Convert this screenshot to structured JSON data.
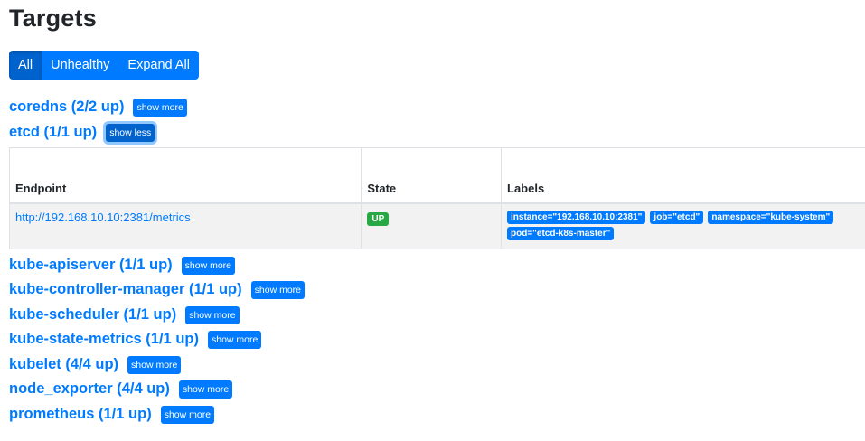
{
  "page": {
    "title": "Targets"
  },
  "filters": {
    "all_label": "All",
    "unhealthy_label": "Unhealthy",
    "expand_all_label": "Expand All"
  },
  "pools_top": [
    {
      "title": "coredns (2/2 up)",
      "toggle": "show more"
    },
    {
      "title": "etcd (1/1 up)",
      "toggle": "show less"
    }
  ],
  "etcd_table": {
    "headers": {
      "endpoint": "Endpoint",
      "state": "State",
      "labels": "Labels"
    },
    "rows": [
      {
        "endpoint": "http://192.168.10.10:2381/metrics",
        "state": "UP",
        "labels": [
          "instance=\"192.168.10.10:2381\"",
          "job=\"etcd\"",
          "namespace=\"kube-system\"",
          "pod=\"etcd-k8s-master\""
        ]
      }
    ]
  },
  "pools_bottom": [
    {
      "title": "kube-apiserver (1/1 up)",
      "toggle": "show more"
    },
    {
      "title": "kube-controller-manager (1/1 up)",
      "toggle": "show more"
    },
    {
      "title": "kube-scheduler (1/1 up)",
      "toggle": "show more"
    },
    {
      "title": "kube-state-metrics (1/1 up)",
      "toggle": "show more"
    },
    {
      "title": "kubelet (4/4 up)",
      "toggle": "show more"
    },
    {
      "title": "node_exporter (4/4 up)",
      "toggle": "show more"
    },
    {
      "title": "prometheus (1/1 up)",
      "toggle": "show more"
    }
  ],
  "colors": {
    "primary": "#007bff",
    "primary_active": "#0062cc",
    "success": "#28a745",
    "row_bg": "#f2f2f2"
  }
}
